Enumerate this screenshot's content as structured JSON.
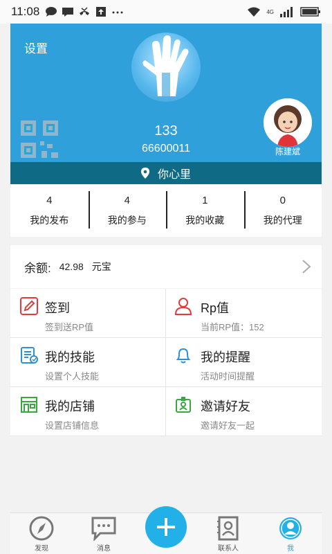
{
  "status_bar": {
    "time": "11:08",
    "network": "4G"
  },
  "header": {
    "settings_label": "设置",
    "username": "133",
    "user_id": "66600011",
    "avatar_name": "陈建斌",
    "location": "你心里",
    "bg_color": "#2fa0da",
    "loc_bar_color": "#0f6a86"
  },
  "stats": [
    {
      "count": "4",
      "label": "我的发布"
    },
    {
      "count": "4",
      "label": "我的参与"
    },
    {
      "count": "1",
      "label": "我的收藏"
    },
    {
      "count": "0",
      "label": "我的代理"
    }
  ],
  "balance": {
    "label": "余额:",
    "value": "42.98",
    "unit": "元宝"
  },
  "grid": [
    {
      "title": "签到",
      "subtitle": "签到送RP值",
      "icon": "pencil-icon"
    },
    {
      "title": "Rp值",
      "subtitle": "当前RP值：152",
      "icon": "user-icon"
    },
    {
      "title": "我的技能",
      "subtitle": "设置个人技能",
      "icon": "skills-icon"
    },
    {
      "title": "我的提醒",
      "subtitle": "活动时间提醒",
      "icon": "bell-icon"
    },
    {
      "title": "我的店铺",
      "subtitle": "设置店铺信息",
      "icon": "store-icon"
    },
    {
      "title": "邀请好友",
      "subtitle": "邀请好友一起",
      "icon": "invite-icon"
    }
  ],
  "nav": {
    "discover": "发现",
    "messages": "消息",
    "contacts": "联系人",
    "me": "我"
  }
}
